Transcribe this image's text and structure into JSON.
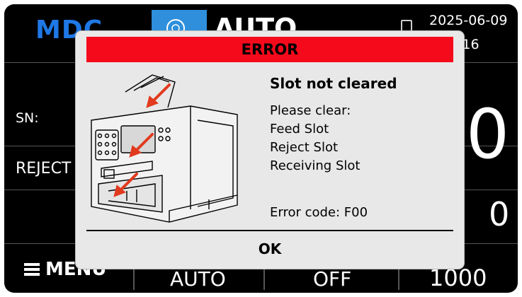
{
  "background": {
    "brand": "MDC",
    "mode": "AUTO",
    "date": "2025-06-09",
    "time": ":16",
    "sn_label": "SN:",
    "reject_label": "REJECT",
    "big_count": "0",
    "reject_count": "0",
    "menu_label": "MENU",
    "footer": [
      "AUTO",
      "OFF",
      "1000"
    ]
  },
  "dialog": {
    "header": "ERROR",
    "title": "Slot not cleared",
    "instruction": "Please clear:",
    "slots": [
      "Feed Slot",
      "Reject Slot",
      "Receiving Slot"
    ],
    "error_code": "Error code: F00",
    "ok_label": "OK"
  },
  "colors": {
    "header_red": "#f50a1c",
    "brand_blue": "#1f78e6",
    "arrow_red": "#e23a1e"
  },
  "icons": [
    "usb-icon",
    "menu-icon",
    "flag-icon",
    "machine-illustration"
  ]
}
